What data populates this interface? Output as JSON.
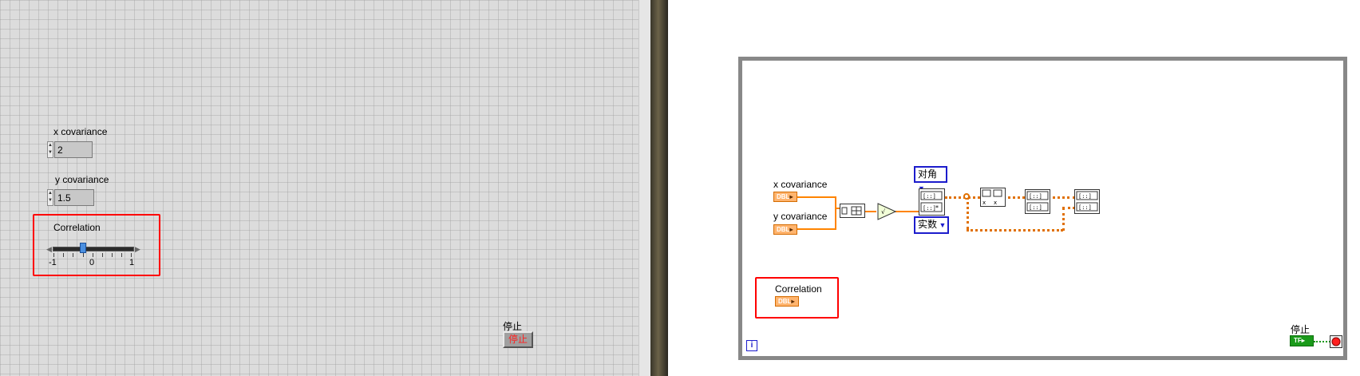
{
  "front_panel": {
    "x_cov": {
      "label": "x covariance",
      "value": "2"
    },
    "y_cov": {
      "label": "y covariance",
      "value": "1.5"
    },
    "correlation": {
      "label": "Correlation",
      "ticks": [
        "-1",
        "0",
        "1"
      ],
      "value": -0.2
    },
    "stop": {
      "label": "停止",
      "button": "停止"
    }
  },
  "block_diagram": {
    "x_cov_label": "x covariance",
    "y_cov_label": "y covariance",
    "corr_label": "Correlation",
    "dbl": "DBL",
    "ring_top": "对角",
    "ring_bottom": "实数",
    "stop_label": "停止",
    "tf": "TF",
    "iteration": "i"
  },
  "colors": {
    "highlight": "#ff0000",
    "wire": "#ff8400",
    "ring_border": "#1c1ccc",
    "bool_green": "#1a9a1a"
  }
}
